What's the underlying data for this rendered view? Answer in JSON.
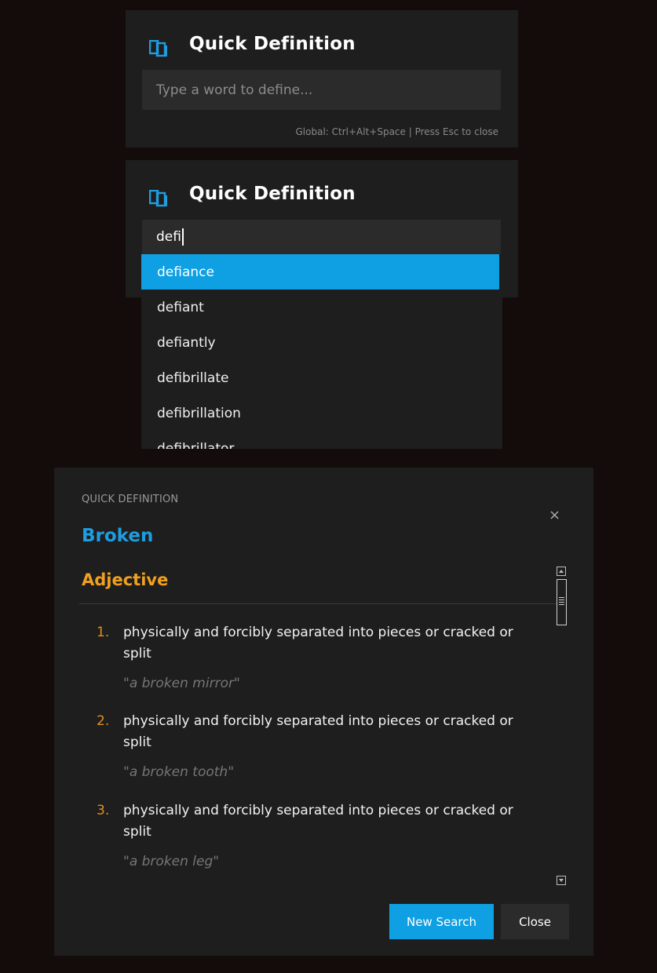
{
  "panel1": {
    "title": "Quick Definition",
    "icon": "book-icon",
    "input_placeholder": "Type a word to define...",
    "hint": "Global: Ctrl+Alt+Space | Press Esc to close"
  },
  "panel2": {
    "title": "Quick Definition",
    "icon": "book-icon",
    "input_value": "defi"
  },
  "autocomplete": {
    "items": [
      "defiance",
      "defiant",
      "defiantly",
      "defibrillate",
      "defibrillation",
      "defibrillator"
    ],
    "selected_index": 0
  },
  "definition": {
    "header_label": "QUICK DEFINITION",
    "word": "Broken",
    "part_of_speech": "Adjective",
    "close_glyph": "×",
    "entries": [
      {
        "num": "1.",
        "text": "physically and forcibly separated into pieces or cracked or split",
        "example": "\"a broken mirror\""
      },
      {
        "num": "2.",
        "text": "physically and forcibly separated into pieces or cracked or split",
        "example": "\"a broken tooth\""
      },
      {
        "num": "3.",
        "text": "physically and forcibly separated into pieces or cracked or split",
        "example": "\"a broken leg\""
      }
    ],
    "buttons": {
      "new_search": "New Search",
      "close": "Close"
    }
  },
  "colors": {
    "background": "#140c0b",
    "panel": "#1e1e1e",
    "input": "#2b2b2b",
    "accent_blue": "#0ea0e3",
    "word_blue": "#1e9de0",
    "pos_orange": "#f0a020"
  }
}
